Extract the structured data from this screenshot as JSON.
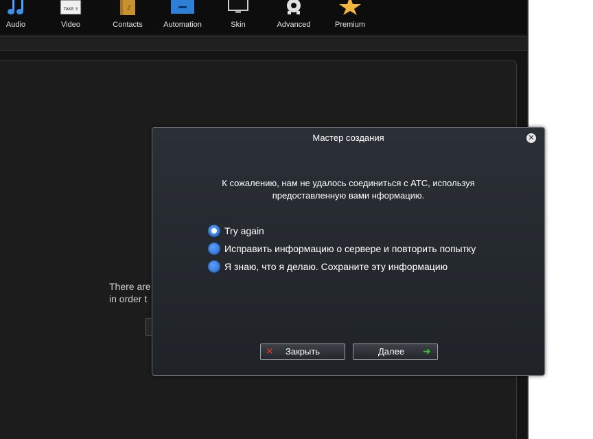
{
  "toolbar": {
    "items": [
      {
        "label": "Audio",
        "icon": "music-note-icon"
      },
      {
        "label": "Video",
        "icon": "clapperboard-icon"
      },
      {
        "label": "Contacts",
        "icon": "address-book-icon"
      },
      {
        "label": "Automation",
        "icon": "robot-icon"
      },
      {
        "label": "Skin",
        "icon": "monitor-icon"
      },
      {
        "label": "Advanced",
        "icon": "gear-icon"
      },
      {
        "label": "Premium",
        "icon": "star-icon"
      }
    ],
    "clapperboard_text": "TAKE 3",
    "contacts_letter": "Z"
  },
  "background": {
    "line1": "There are",
    "line2": "in order t"
  },
  "dialog": {
    "title": "Мастер создания",
    "message_line1": "К сожалению, нам не удалось соединиться с АТС, используя",
    "message_line2": "предоставленную вами нформацию.",
    "options": [
      {
        "label": "Try again",
        "selected": true
      },
      {
        "label": "Исправить информацию о сервере и повторить попытку",
        "selected": false
      },
      {
        "label": "Я знаю, что я делаю. Сохраните эту информацию",
        "selected": false
      }
    ],
    "close_button": "Закрыть",
    "next_button": "Далее"
  },
  "colors": {
    "radio": "#2f79dc",
    "close_icon": "#e53030",
    "next_arrow": "#32c832"
  }
}
